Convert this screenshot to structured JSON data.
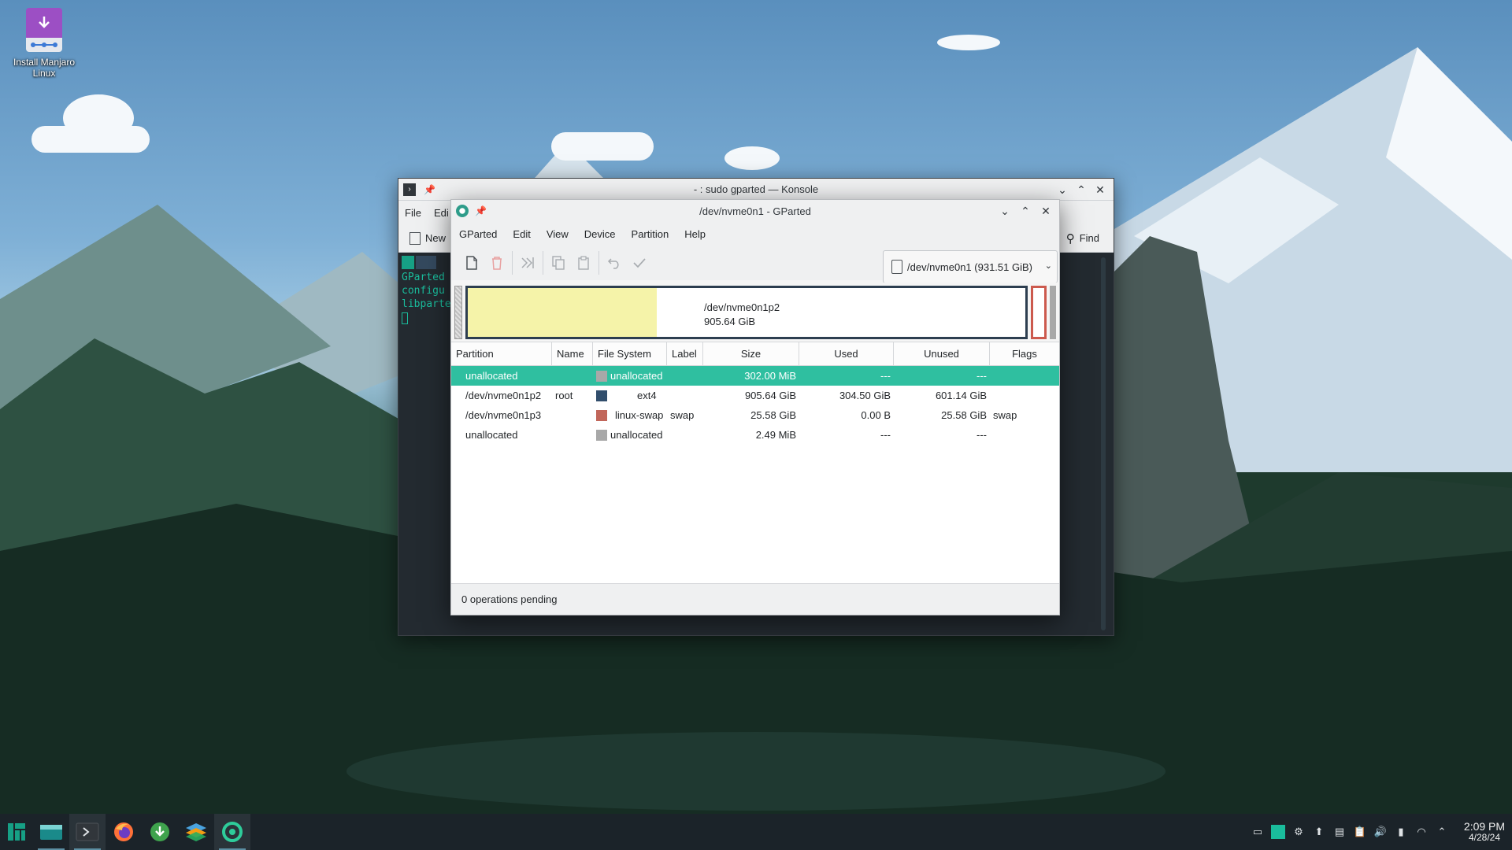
{
  "desktop": {
    "icon_label": "Install Manjaro Linux"
  },
  "konsole": {
    "title": "- : sudo gparted — Konsole",
    "menu": [
      "File",
      "Edi"
    ],
    "toolbar_new": "New",
    "toolbar_find": "Find",
    "lines": [
      "GParted",
      "configu",
      "libparte"
    ]
  },
  "gparted": {
    "title": "/dev/nvme0n1 - GParted",
    "menu": [
      "GParted",
      "Edit",
      "View",
      "Device",
      "Partition",
      "Help"
    ],
    "device": "/dev/nvme0n1 (931.51 GiB)",
    "diskmap": {
      "partition": "/dev/nvme0n1p2",
      "size": "905.64 GiB"
    },
    "columns": [
      "Partition",
      "Name",
      "File System",
      "Label",
      "Size",
      "Used",
      "Unused",
      "Flags"
    ],
    "rows": [
      {
        "partition": "unallocated",
        "name": "",
        "fs": "unallocated",
        "fs_color": "#a8a8a8",
        "label": "",
        "size": "302.00 MiB",
        "used": "---",
        "unused": "---",
        "flags": "",
        "selected": true
      },
      {
        "partition": "/dev/nvme0n1p2",
        "name": "root",
        "fs": "ext4",
        "fs_color": "#314e6c",
        "label": "",
        "size": "905.64 GiB",
        "used": "304.50 GiB",
        "unused": "601.14 GiB",
        "flags": "",
        "selected": false
      },
      {
        "partition": "/dev/nvme0n1p3",
        "name": "",
        "fs": "linux-swap",
        "fs_color": "#c1665a",
        "label": "swap",
        "size": "25.58 GiB",
        "used": "0.00 B",
        "unused": "25.58 GiB",
        "flags": "swap",
        "selected": false
      },
      {
        "partition": "unallocated",
        "name": "",
        "fs": "unallocated",
        "fs_color": "#a8a8a8",
        "label": "",
        "size": "2.49 MiB",
        "used": "---",
        "unused": "---",
        "flags": "",
        "selected": false
      }
    ],
    "status": "0 operations pending"
  },
  "taskbar": {
    "time": "2:09 PM",
    "date": "4/28/24"
  },
  "colors": {
    "selection": "#2fbfa0",
    "ext4": "#314e6c",
    "swap": "#c1665a",
    "unallocated": "#a8a8a8",
    "used_space": "#f5f3a9"
  }
}
